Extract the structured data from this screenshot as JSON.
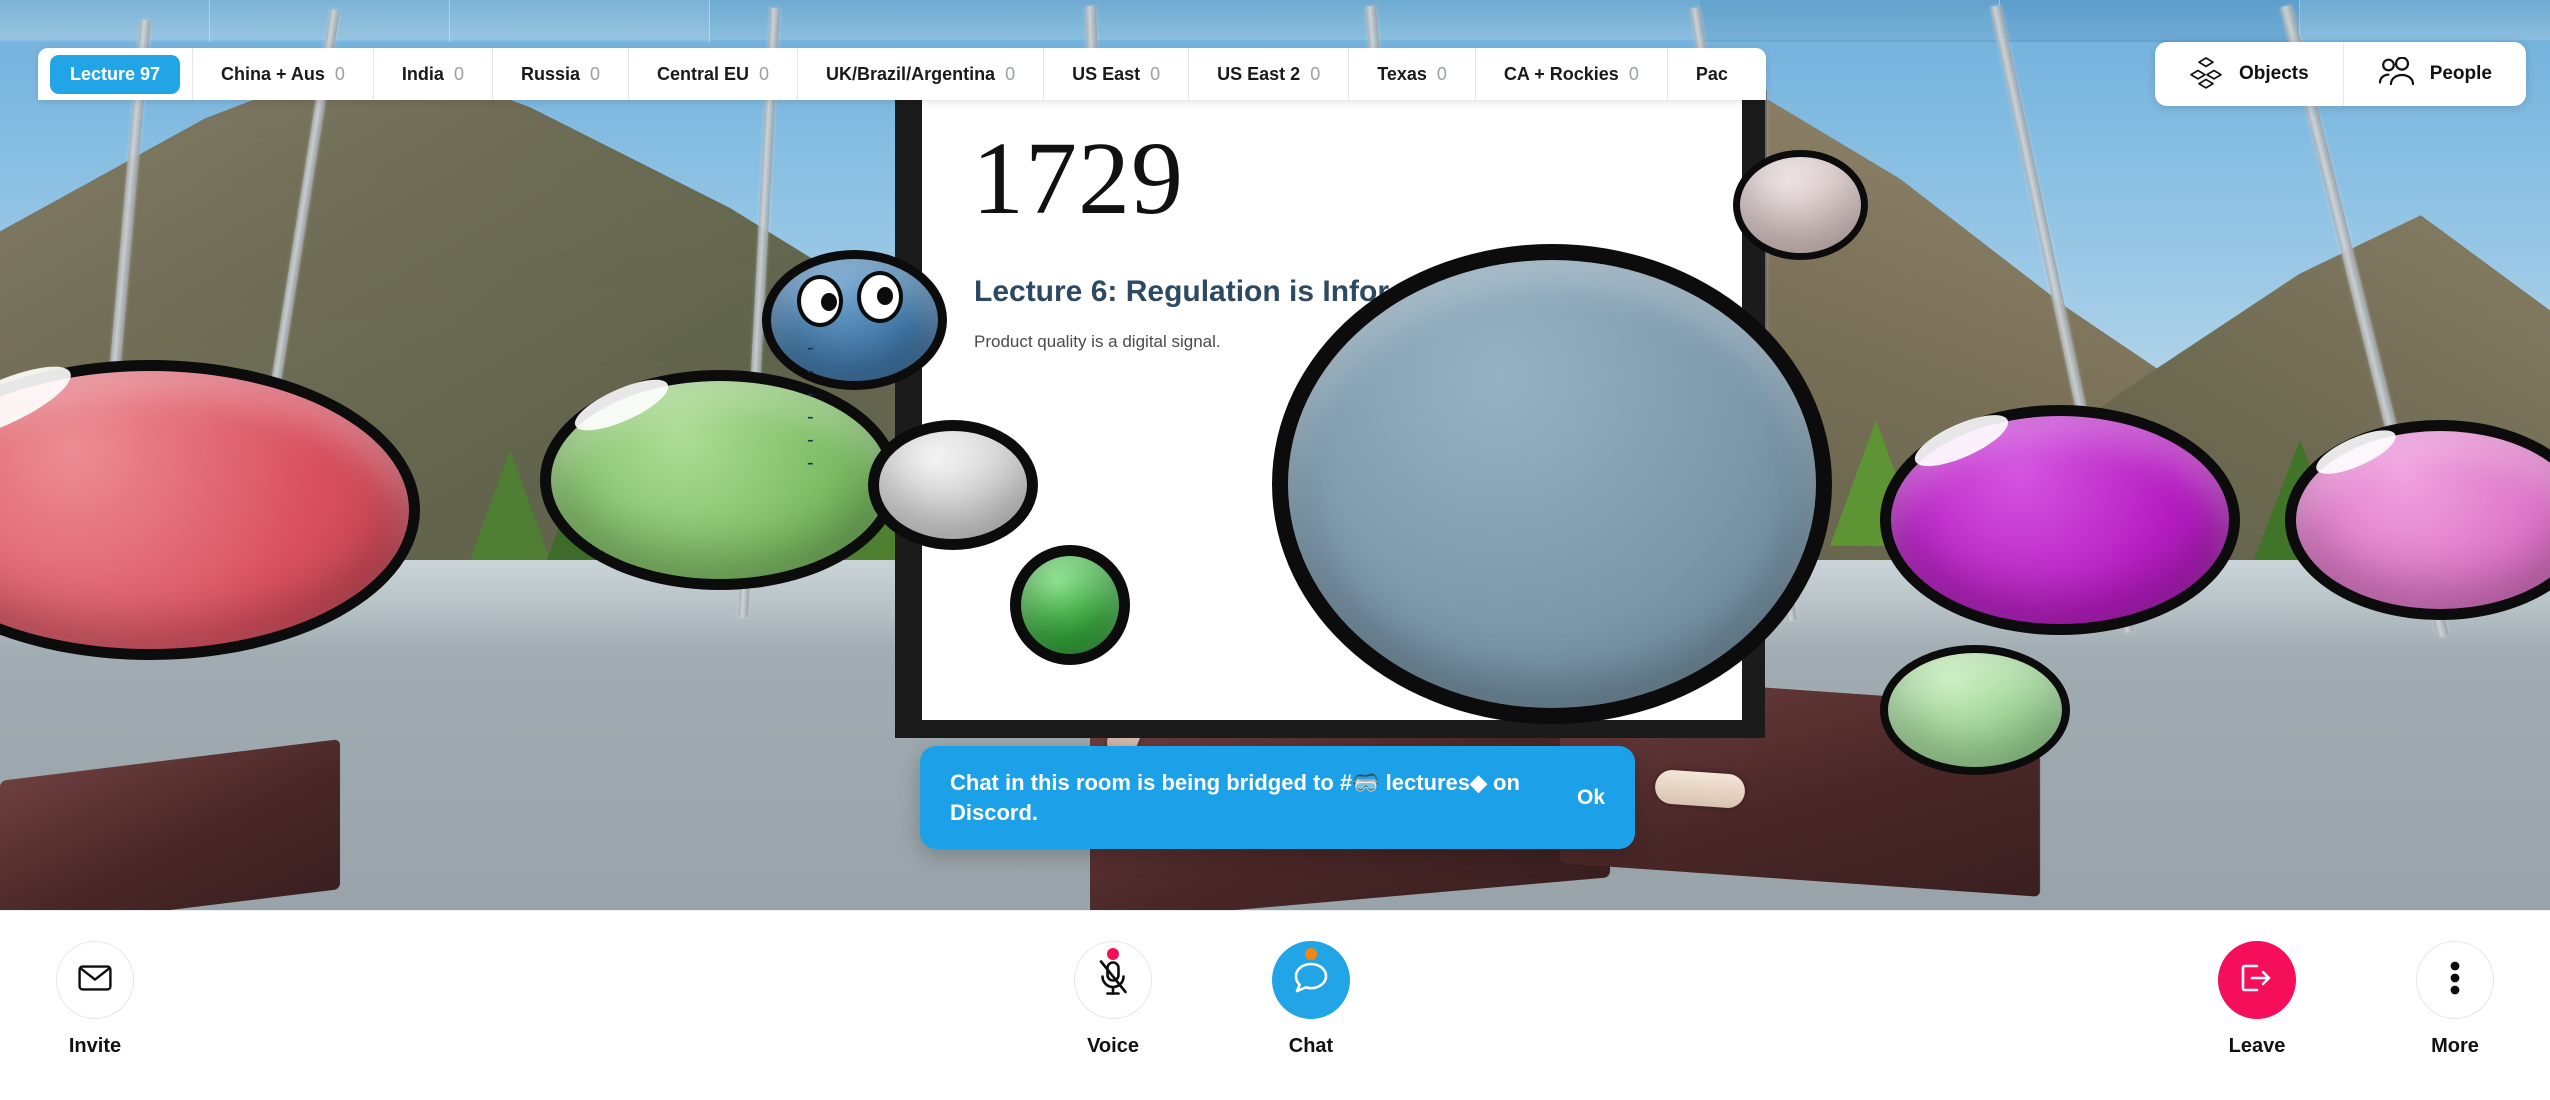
{
  "tabbar": {
    "active_tab": {
      "label": "Lecture 97",
      "count": ""
    },
    "tabs": [
      {
        "label": "China + Aus",
        "count": "0"
      },
      {
        "label": "India",
        "count": "0"
      },
      {
        "label": "Russia",
        "count": "0"
      },
      {
        "label": "Central EU",
        "count": "0"
      },
      {
        "label": "UK/Brazil/Argentina",
        "count": "0"
      },
      {
        "label": "US East",
        "count": "0"
      },
      {
        "label": "US East 2",
        "count": "0"
      },
      {
        "label": "Texas",
        "count": "0"
      },
      {
        "label": "CA + Rockies",
        "count": "0"
      },
      {
        "label": "Pac",
        "count": ""
      }
    ]
  },
  "right_panel": {
    "objects": {
      "label": "Objects",
      "icon": "cubes-icon"
    },
    "people": {
      "label": "People",
      "icon": "people-icon"
    }
  },
  "slide": {
    "number": "1729",
    "title": "Lecture 6: Regulation is Infor",
    "subtitle": "Product quality is a digital signal."
  },
  "toast": {
    "message": "Chat in this room is being bridged to #🥽 lectures◆ on Discord.",
    "ok_label": "Ok",
    "color": "#1ca0e8"
  },
  "toolbar": {
    "left": [
      {
        "label": "Invite",
        "icon": "mail-icon",
        "style": "outline",
        "badge": ""
      }
    ],
    "center": [
      {
        "label": "Voice",
        "icon": "mic-muted-icon",
        "style": "outline",
        "badge": "red"
      },
      {
        "label": "Chat",
        "icon": "chat-bubble-icon",
        "style": "blue",
        "badge": "orange"
      }
    ],
    "right": [
      {
        "label": "Leave",
        "icon": "exit-icon",
        "style": "pink",
        "badge": ""
      },
      {
        "label": "More",
        "icon": "dots-vertical-icon",
        "style": "outline",
        "badge": ""
      }
    ]
  },
  "colors": {
    "accent_blue": "#21a5e6",
    "leave_pink": "#f50f5a",
    "badge_orange": "#f5870f",
    "tab_text": "#1a1a1a",
    "tab_count": "#9aa0a6"
  },
  "scene": {
    "avatars": [
      {
        "name": "red-blob",
        "color": "#e0636f"
      },
      {
        "name": "green-blob",
        "color": "#8fc77a"
      },
      {
        "name": "blue-face-blob",
        "color": "#4f86b8"
      },
      {
        "name": "gray-blob",
        "color": "#d6d6d6"
      },
      {
        "name": "small-green-blob",
        "color": "#3fb344"
      },
      {
        "name": "big-slate-blob",
        "color": "#7e9bad"
      },
      {
        "name": "tan-blob",
        "color": "#d9c5c3"
      },
      {
        "name": "purple-blob",
        "color": "#bd1fc6"
      },
      {
        "name": "pink-blob",
        "color": "#e07ccb"
      },
      {
        "name": "mint-blob",
        "color": "#9ed89a"
      }
    ]
  }
}
